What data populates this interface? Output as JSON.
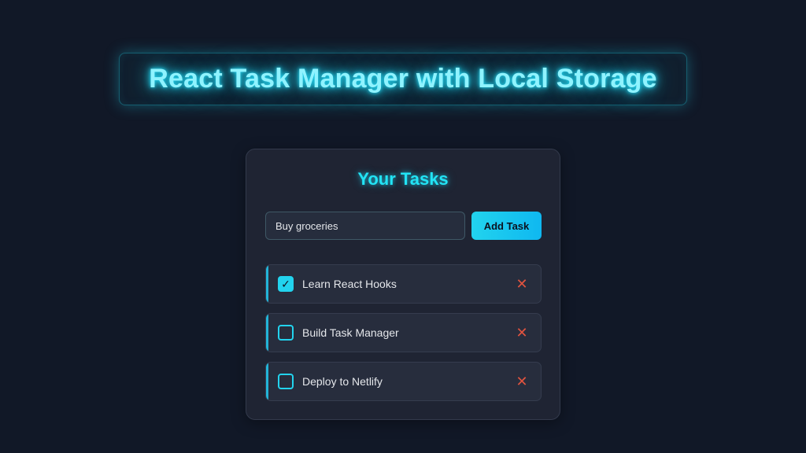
{
  "header": {
    "title": "React Task Manager with Local Storage"
  },
  "card": {
    "title": "Your Tasks",
    "input": {
      "value": "Buy groceries",
      "placeholder": ""
    },
    "add_button_label": "Add Task",
    "tasks": [
      {
        "text": "Learn React Hooks",
        "completed": true,
        "check_glyph": "✓",
        "delete_glyph": "✕"
      },
      {
        "text": "Build Task Manager",
        "completed": false,
        "check_glyph": "",
        "delete_glyph": "✕"
      },
      {
        "text": "Deploy to Netlify",
        "completed": false,
        "check_glyph": "",
        "delete_glyph": "✕"
      }
    ]
  },
  "colors": {
    "background": "#111827",
    "accent": "#22d3ee",
    "card": "#1f2433",
    "delete": "#e0533f"
  },
  "icons": {
    "check": "checkmark-icon",
    "delete": "close-icon"
  }
}
